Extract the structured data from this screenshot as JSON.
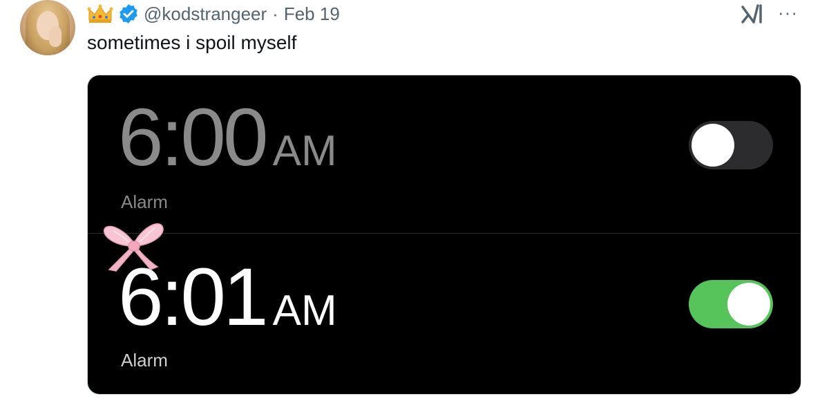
{
  "tweet": {
    "handle": "@kodstrangeer",
    "separator": "·",
    "date": "Feb 19",
    "text": "sometimes i spoil myself",
    "more_label": "···"
  },
  "icons": {
    "crown": "crown-emoji",
    "verified": "verified-badge-icon",
    "grok": "grok-icon",
    "more": "more-options-icon",
    "bow": "pink-bow-emoji"
  },
  "alarms": [
    {
      "hour_min": "6:00",
      "ampm": "AM",
      "label": "Alarm",
      "enabled": false
    },
    {
      "hour_min": "6:01",
      "ampm": "AM",
      "label": "Alarm",
      "enabled": true
    }
  ],
  "colors": {
    "verified_blue": "#1d9bf0",
    "toggle_on": "#56c45a",
    "toggle_off": "#2c2c2e",
    "text_secondary": "#536471"
  }
}
